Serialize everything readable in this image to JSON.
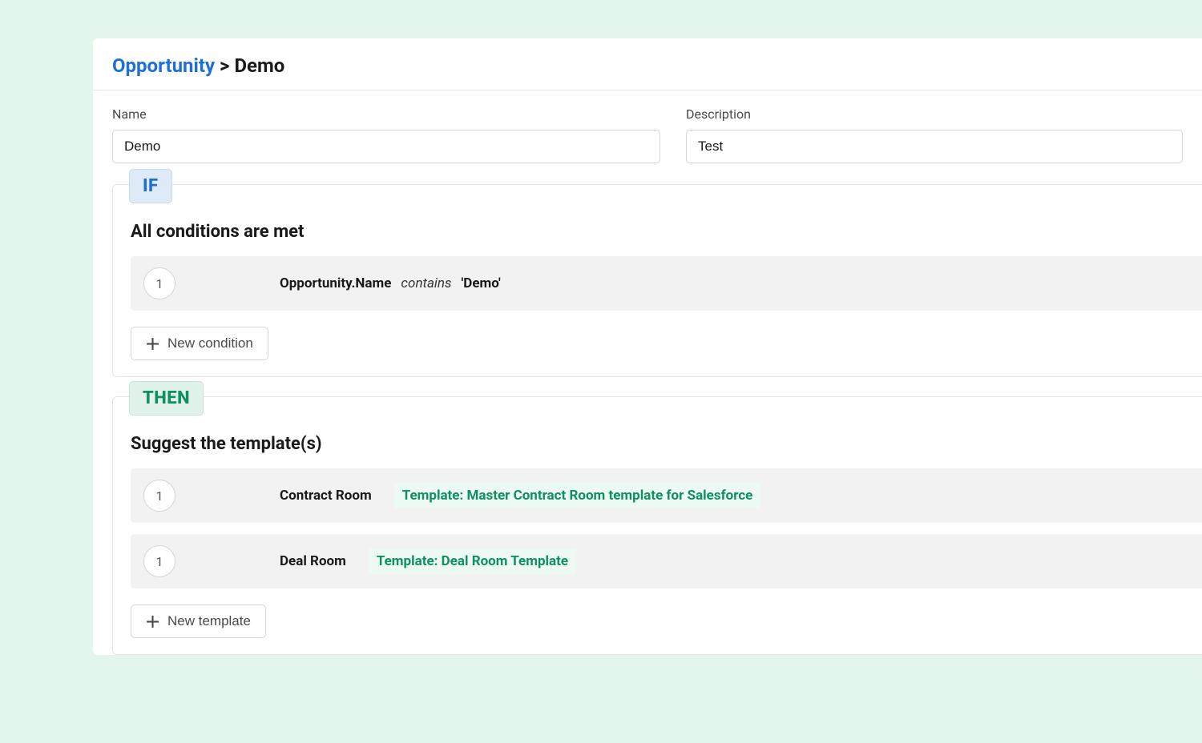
{
  "breadcrumb": {
    "root": "Opportunity",
    "separator": ">",
    "current": "Demo"
  },
  "fields": {
    "name_label": "Name",
    "name_value": "Demo",
    "description_label": "Description",
    "description_value": "Test"
  },
  "if_section": {
    "badge": "IF",
    "title": "All conditions are met",
    "conditions": [
      {
        "index": "1",
        "field": "Opportunity.Name",
        "operator": "contains",
        "value": "'Demo'"
      }
    ],
    "new_button": "New condition"
  },
  "then_section": {
    "badge": "THEN",
    "title": "Suggest the template(s)",
    "templates": [
      {
        "index": "1",
        "room": "Contract Room",
        "template": "Template: Master Contract Room template for Salesforce"
      },
      {
        "index": "1",
        "room": "Deal Room",
        "template": "Template: Deal Room Template"
      }
    ],
    "new_button": "New template"
  }
}
